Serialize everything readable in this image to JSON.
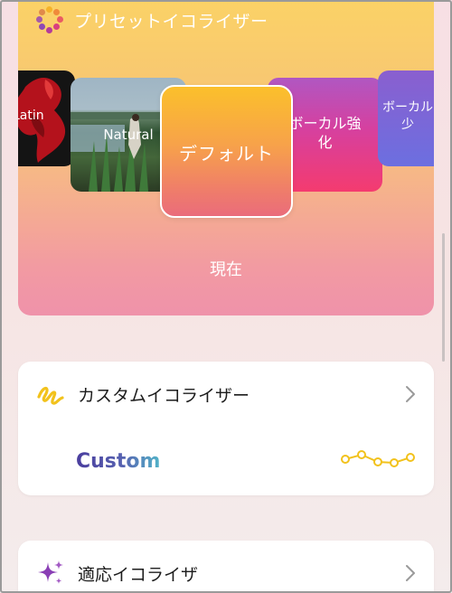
{
  "header": {
    "title": "プリセットイコライザー",
    "icon": "dots-ring-icon"
  },
  "presets": {
    "items": [
      {
        "label": "Latin"
      },
      {
        "label": "Natural"
      },
      {
        "label": "デフォルト"
      },
      {
        "label": "ボーカル強化",
        "line1": "ボーカル強",
        "line2": "化"
      },
      {
        "label": "ボーカル少",
        "line1": "ボーカル",
        "line2": "少"
      }
    ],
    "selected_index": 2,
    "status_label": "現在"
  },
  "custom_eq": {
    "title": "カスタムイコライザー",
    "value": "Custom",
    "icon": "squiggle-icon"
  },
  "adaptive_eq": {
    "title": "適応イコライザ",
    "icon": "sparkle-icon"
  },
  "colors": {
    "accent_yellow": "#f2c21c",
    "sparkle_purple": "#8a3fb5",
    "custom_gradient_start": "#4a3d9e",
    "custom_gradient_end": "#52b3c8"
  }
}
